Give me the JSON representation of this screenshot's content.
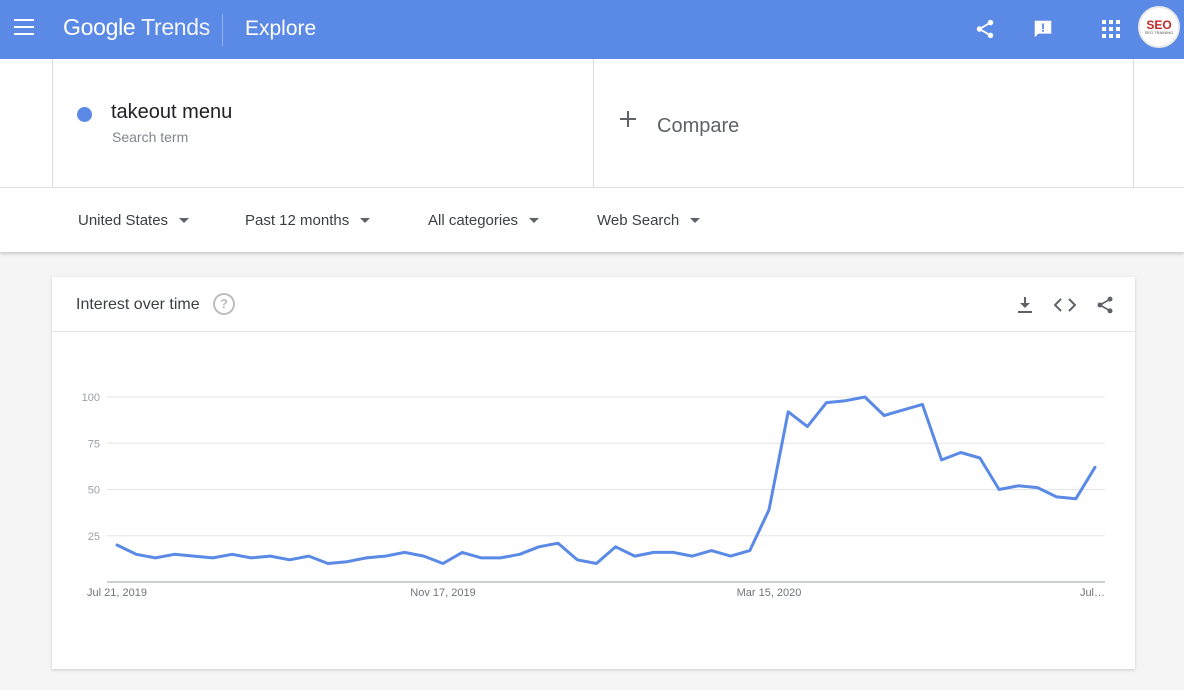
{
  "header": {
    "logo_google": "Google",
    "logo_trends": "Trends",
    "page_title": "Explore",
    "avatar_text": "SEO",
    "avatar_subtext": "SEO TRAINING"
  },
  "terms": {
    "term1": {
      "label": "takeout menu",
      "sublabel": "Search term",
      "color": "#5b8ae6"
    },
    "compare_label": "Compare"
  },
  "filters": {
    "region": "United States",
    "time": "Past 12 months",
    "category": "All categories",
    "search_type": "Web Search"
  },
  "card": {
    "title": "Interest over time",
    "help_symbol": "?"
  },
  "chart_data": {
    "type": "line",
    "y_ticks": [
      "100",
      "75",
      "50",
      "25"
    ],
    "ylim": [
      0,
      100
    ],
    "x_tick_labels": [
      "Jul 21, 2019",
      "Nov 17, 2019",
      "Mar 15, 2020",
      "Jul…"
    ],
    "line_color": "#5b8ae6",
    "grid": true,
    "series": [
      {
        "values": [
          20,
          15,
          13,
          15,
          14,
          13,
          15,
          13,
          14,
          12,
          14,
          10,
          11,
          13,
          14,
          16,
          14,
          10,
          16,
          13,
          13,
          15,
          19,
          21,
          12,
          10,
          19,
          14,
          16,
          16,
          14,
          17,
          14,
          17,
          39,
          92,
          84,
          97,
          98,
          100,
          90,
          93,
          96,
          66,
          70,
          67,
          50,
          52,
          51,
          46,
          45,
          62
        ]
      }
    ]
  }
}
